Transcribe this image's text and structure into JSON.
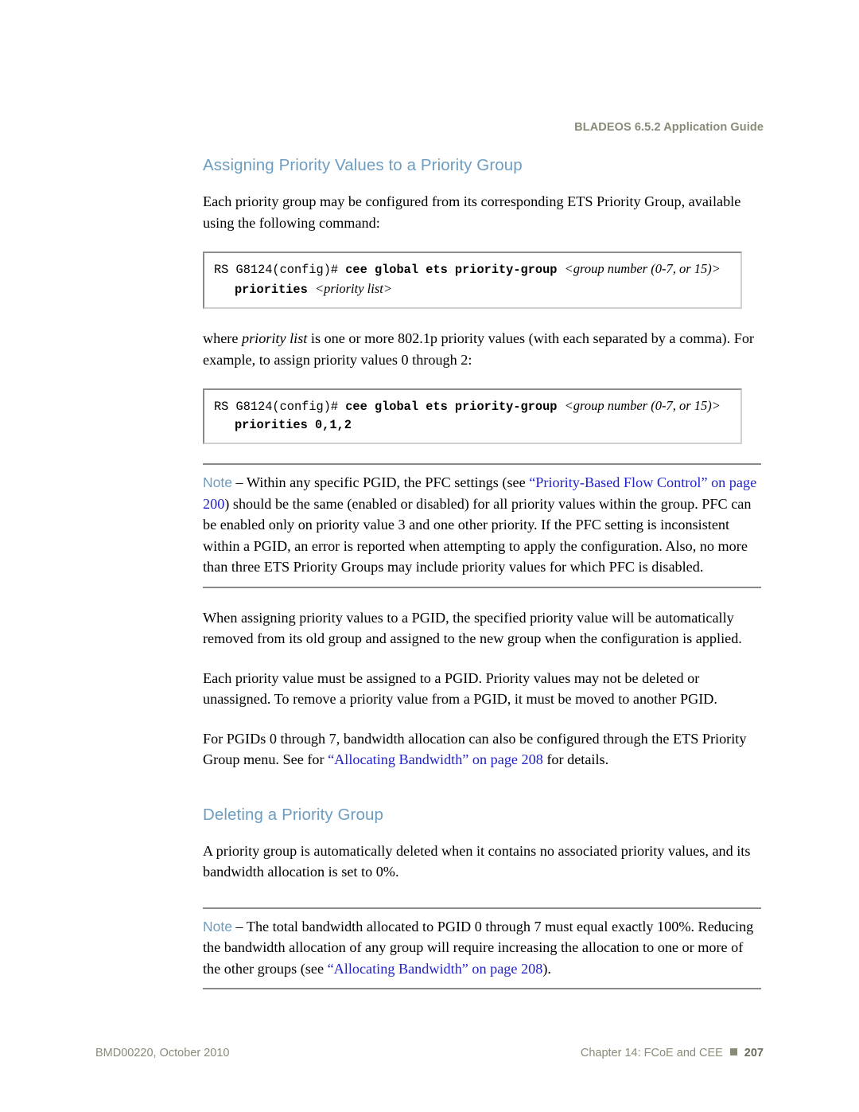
{
  "header": {
    "running_title": "BLADEOS 6.5.2 Application Guide"
  },
  "sections": [
    {
      "title": "Assigning Priority Values to a Priority Group"
    },
    {
      "title": "Deleting a Priority Group"
    }
  ],
  "paragraphs": {
    "intro": "Each priority group may be configured from its corresponding ETS Priority Group, available using the following command:",
    "where_pre": "where ",
    "where_ital": "priority list",
    "where_post": " is one or more 802.1p priority values (with each separated by a comma). For example, to assign priority values 0 through 2:",
    "assign_removed": "When assigning priority values to a PGID, the specified priority value will be automatically removed from its old group and assigned to the new group when the configuration is applied.",
    "must_assign": "Each priority value must be assigned to a PGID. Priority values may not be deleted or unassigned. To remove a priority value from a PGID, it must be moved to another PGID.",
    "bandwidth_pre": "For PGIDs 0 through 7, bandwidth allocation can also be configured through the ETS Priority Group menu. See for ",
    "bandwidth_link": "“Allocating Bandwidth” on page 208",
    "bandwidth_post": " for details.",
    "deleting_body": "A priority group is automatically deleted when it contains no associated priority values, and its bandwidth allocation is set to 0%."
  },
  "code_blocks": [
    {
      "line1_prompt": "RS G8124(config)# ",
      "line1_command": "cee global ets priority-group ",
      "line1_variable": "<group number (0-7, or 15)>",
      "line2_command": "priorities ",
      "line2_variable": "<priority list>"
    },
    {
      "line1_prompt": "RS G8124(config)# ",
      "line1_command": "cee global ets priority-group ",
      "line1_variable": "<group number (0-7, or 15)>",
      "line2_command": "priorities 0,1,2",
      "line2_variable": ""
    }
  ],
  "notes": [
    {
      "label": "Note",
      "dash": " – ",
      "text_1": "Within any specific PGID, the PFC settings (see ",
      "link_1": "“Priority-Based Flow Control” on page 200",
      "text_2": ") should be the same (enabled or disabled) for all priority values within the group. PFC can be enabled only on priority value 3 and one other priority. If the PFC setting is inconsistent within a PGID, an error is reported when attempting to apply the configuration. Also, no more than three ETS Priority Groups may include priority values for which PFC is disabled."
    },
    {
      "label": "Note",
      "dash": " – ",
      "text_1": "The total bandwidth allocated to PGID 0 through 7 must equal exactly 100%. Reducing the bandwidth allocation of any group will require increasing the allocation to one or more of the other groups (see ",
      "link_1": "“Allocating Bandwidth” on page 208",
      "text_2": ")."
    }
  ],
  "footer": {
    "document_id": "BMD00220, October 2010",
    "chapter": "Chapter 14: FCoE and CEE",
    "page_number": "207"
  },
  "colors": {
    "heading": "#6d9dc0",
    "link": "#2222cc",
    "header_footer": "#8a8a78",
    "rule": "#8a8a8a"
  }
}
